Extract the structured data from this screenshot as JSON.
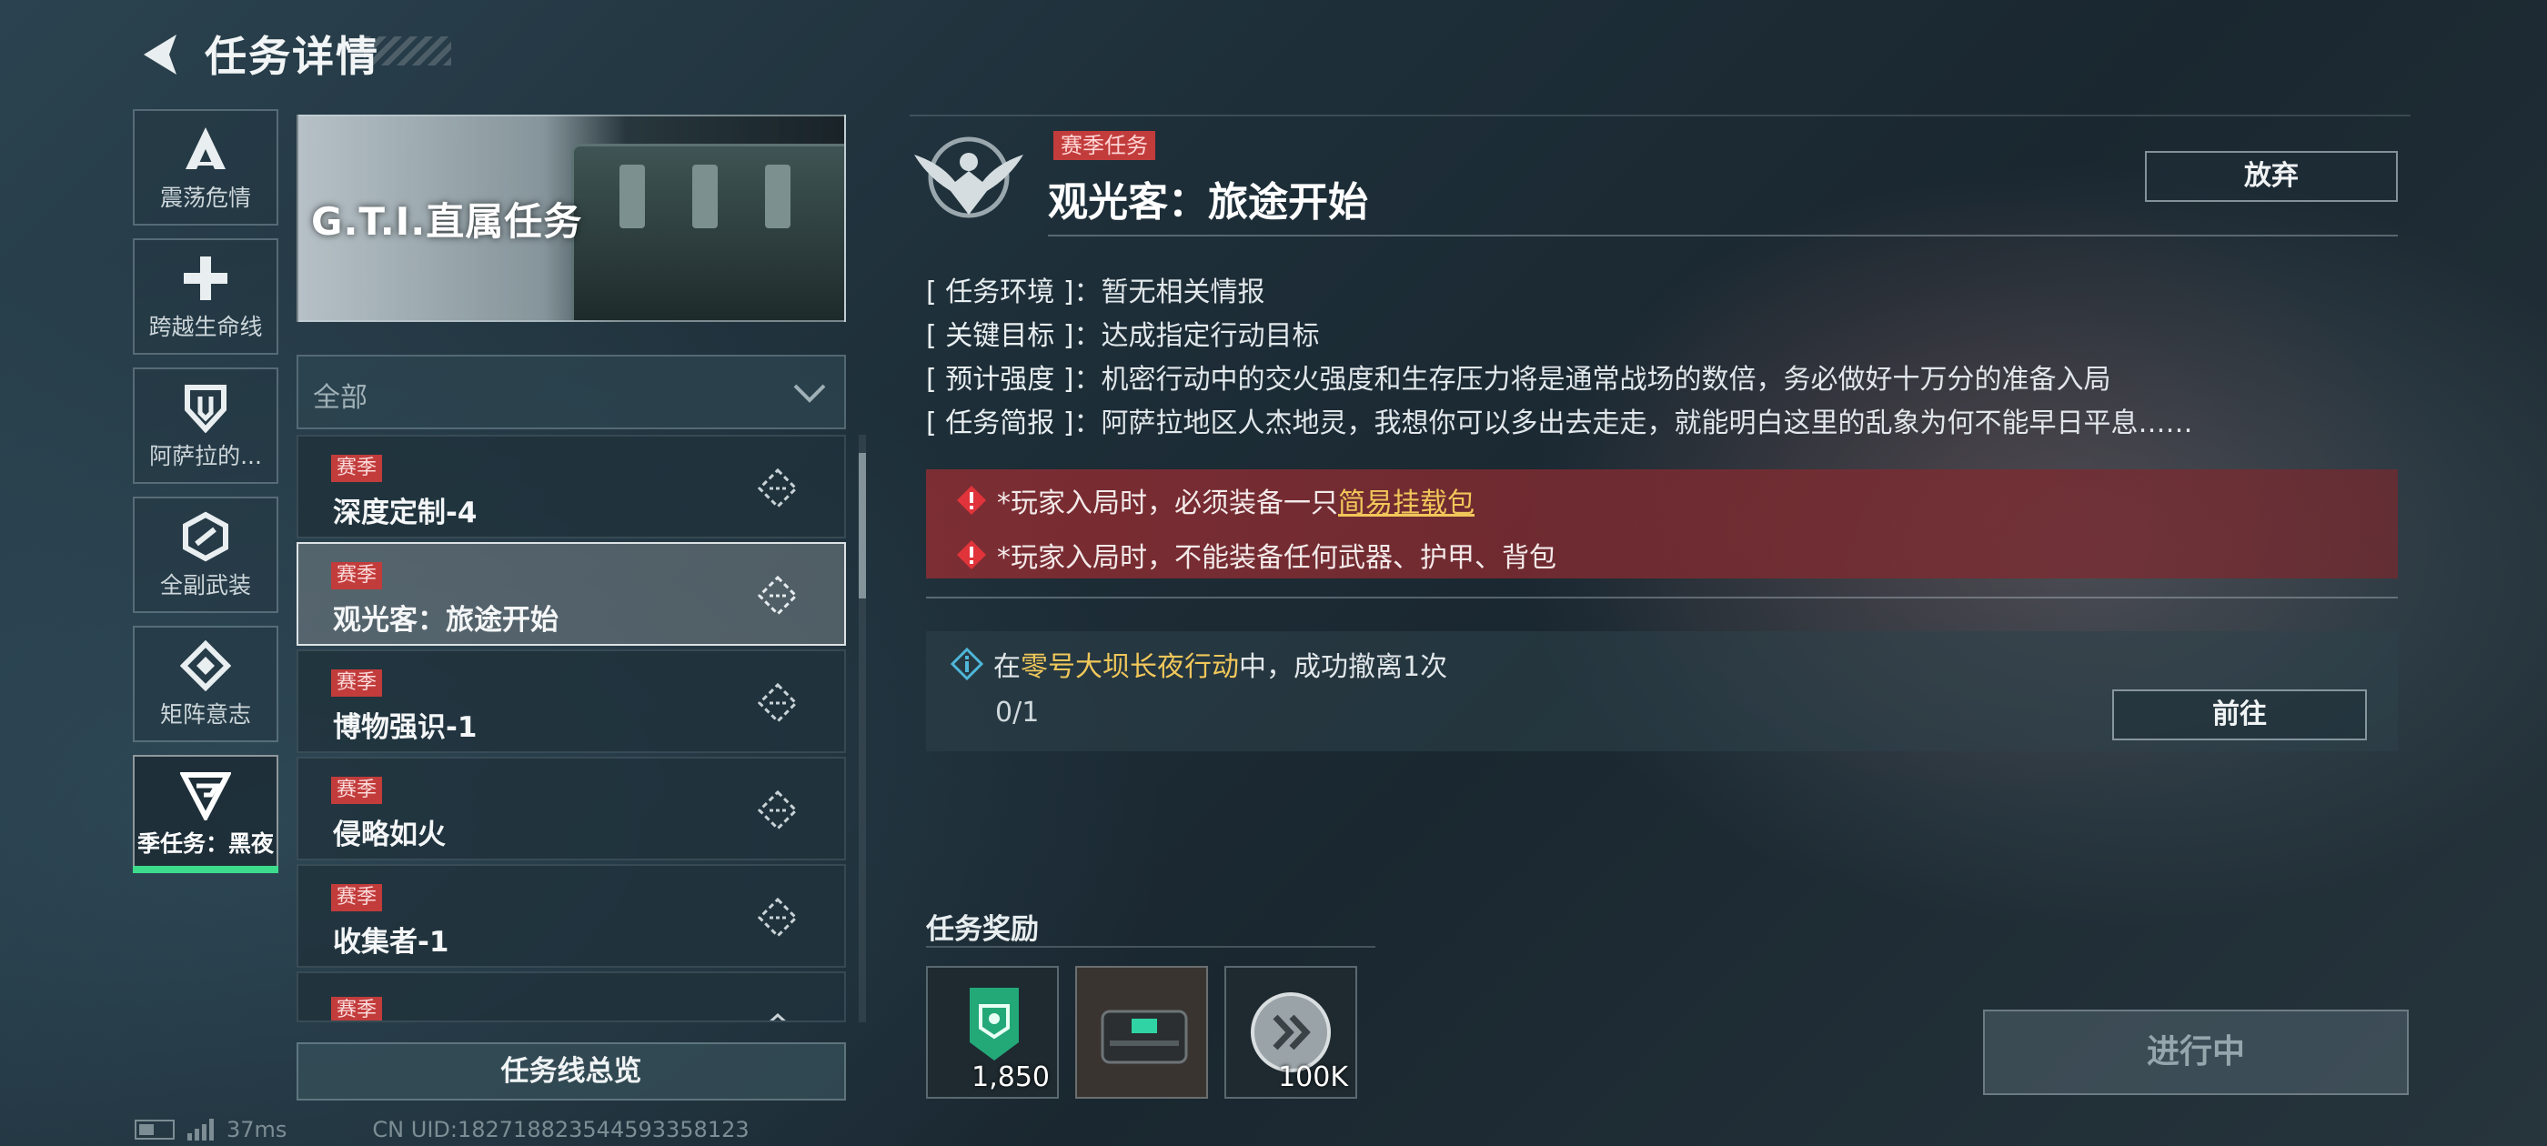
{
  "header": {
    "title": "任务详情"
  },
  "nav": {
    "items": [
      {
        "label": "震荡危情",
        "icon": "a-emblem-icon"
      },
      {
        "label": "跨越生命线",
        "icon": "cross-icon"
      },
      {
        "label": "阿萨拉的...",
        "icon": "shield-icon"
      },
      {
        "label": "全副武装",
        "icon": "hex-emblem-icon"
      },
      {
        "label": "矩阵意志",
        "icon": "diamond-emblem-icon"
      },
      {
        "label": "季任务：黑夜",
        "icon": "g-emblem-icon",
        "active": true
      }
    ]
  },
  "banner": {
    "title": "G.T.I.直属任务"
  },
  "filter": {
    "label": "全部"
  },
  "list": {
    "items": [
      {
        "tag": "赛季",
        "name": "深度定制-4"
      },
      {
        "tag": "赛季",
        "name": "观光客：旅途开始",
        "selected": true
      },
      {
        "tag": "赛季",
        "name": "博物强识-1"
      },
      {
        "tag": "赛季",
        "name": "侵略如火"
      },
      {
        "tag": "赛季",
        "name": "收集者-1"
      },
      {
        "tag": "赛季",
        "name": ""
      }
    ],
    "overview_label": "任务线总览"
  },
  "status": {
    "ping": "37ms",
    "uid": "CN UID:1827188235445933581​23"
  },
  "detail": {
    "type_tag": "赛季任务",
    "title": "观光客：旅途开始",
    "abandon_label": "放弃",
    "info": [
      {
        "key": "[ 任务环境 ]",
        "value": "：暂无相关情报"
      },
      {
        "key": "[ 关键目标 ]",
        "value": "：达成指定行动目标"
      },
      {
        "key": "[ 预计强度 ]",
        "value": "：机密行动中的交火强度和生存压力将是通常战场的数倍，务必做好十万分的准备入局"
      },
      {
        "key": "[ 任务简报 ]",
        "value": "：阿萨拉地区人杰地灵，我想你可以多出去走走，就能明白这里的乱象为何不能早日平息……"
      }
    ],
    "warnings": [
      {
        "prefix": "*玩家入局时，必须装备一只",
        "highlight": "简易挂载包",
        "suffix": ""
      },
      {
        "prefix": "*玩家入局时，不能装备任何武器、护甲、背包",
        "highlight": "",
        "suffix": ""
      }
    ],
    "objective": {
      "prefix": "在",
      "highlight": "零号大坝长夜行动",
      "suffix": "中，成功撤离1次",
      "progress": "0/1",
      "goto_label": "前往"
    },
    "reward_title": "任务奖励",
    "rewards": [
      {
        "qty": "1,850",
        "icon": "experience-badge-icon"
      },
      {
        "qty": "",
        "icon": "mounting-pack-icon"
      },
      {
        "qty": "100K",
        "icon": "coin-icon"
      }
    ],
    "status_button": "进行中"
  },
  "colors": {
    "accent": "#3ddc8c",
    "tag_red": "#c23c3c",
    "highlight": "#f1c75a",
    "warn_bg": "#8c2d32"
  }
}
